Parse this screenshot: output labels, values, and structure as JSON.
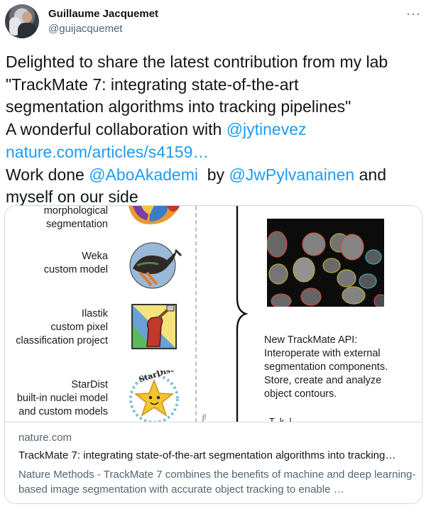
{
  "author": {
    "name": "Guillaume Jacquemet",
    "handle": "@guijacquemet"
  },
  "menu_label": "···",
  "tweet": {
    "line1": "Delighted to share the latest contribution from my lab",
    "line2": "\"TrackMate 7: integrating state-of-the-art",
    "line3": "segmentation algorithms into tracking pipelines\"",
    "line4_pre": "A wonderful collaboration with ",
    "mention1": "@jytinevez",
    "url": "nature.com/articles/s4159…",
    "line6_pre": "Work done ",
    "mention2": "@AboAkademi",
    "line6_mid": "  by ",
    "mention3": "@JwPylvanainen",
    "line6_post": " and",
    "line7": "myself on our side"
  },
  "figure": {
    "labels": {
      "morph": "morphological\nsegmentation",
      "weka": "Weka\ncustom model",
      "ilastik": "Ilastik\ncustom pixel\nclassification project",
      "stardist": "StarDist\nbuilt-in nuclei model\nand custom models"
    },
    "stardist_logo_text": "StarDist",
    "api_text": "New TrackMate API:\nInteroperate with external\nsegmentation components.\nStore, create and analyze\nobject contours.",
    "cut_text": "T  k  l",
    "cut_mark": "j!"
  },
  "card": {
    "domain": "nature.com",
    "title": "TrackMate 7: integrating state-of-the-art segmentation algorithms into tracking…",
    "description": "Nature Methods - TrackMate 7 combines the benefits of machine and deep learning-based image segmentation with accurate object tracking to enable …"
  }
}
